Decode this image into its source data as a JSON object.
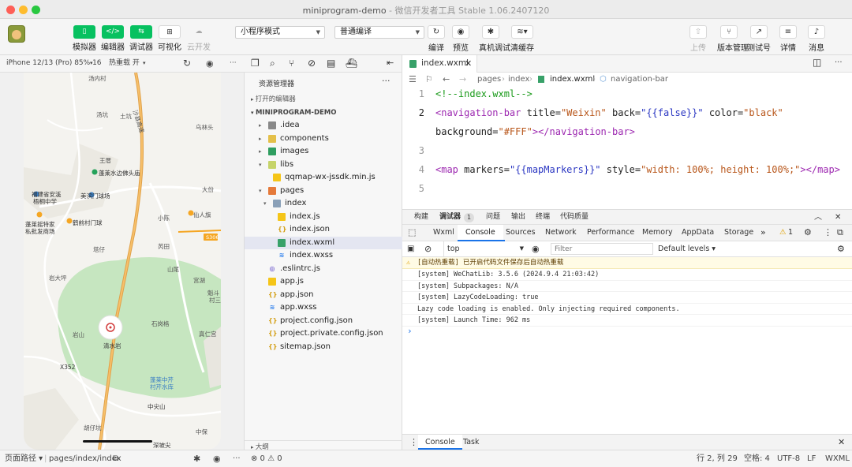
{
  "window": {
    "title": "miniprogram-demo",
    "subtitle": " - 微信开发者工具 Stable 1.06.2407120"
  },
  "toolbar": {
    "simulator": "模拟器",
    "editor": "编辑器",
    "debugger": "调试器",
    "visual": "可视化",
    "cloud": "云开发",
    "mode_select": "小程序模式",
    "compile_select": "普通编译",
    "compile": "编译",
    "preview": "预览",
    "remote_debug": "真机调试",
    "clear_cache": "清缓存",
    "upload": "上传",
    "version": "版本管理",
    "test_account": "测试号",
    "details": "详情",
    "messages": "消息"
  },
  "simulator": {
    "device": "iPhone 12/13 (Pro) 85% 16",
    "hot_reload": "热重载 开"
  },
  "map_labels": {
    "l1": "汤内村",
    "l2": "沙县高速",
    "l3": "汤坑",
    "l4": "土坑",
    "l5": "乌林头",
    "l6": "王厝",
    "l7": "蓬莱水边佛头庙",
    "l8": "福建省安溪",
    "l9": "梧桐中学",
    "l10": "美滨门球场",
    "l11": "大份",
    "l12": "蓬莱摇特家",
    "l13": "私批发商场",
    "l14": "鹤前村门球",
    "l15": "小陈",
    "l16": "仙人旗",
    "l17": "塔仔",
    "l18": "芮田",
    "l19": "S306",
    "l20": "岩大坪",
    "l21": "山尾",
    "l22": "宫湖",
    "l23": "魁斗",
    "l24": "村三",
    "l25": "石岗格",
    "l26": "岩山",
    "l27": "清水岩",
    "l28": "真仁宫",
    "l29": "X352",
    "l30": "蓬莱中芹",
    "l31": "村芹水库",
    "l32": "中尖山",
    "l33": "胡仔坑",
    "l34": "中保",
    "l35": "深坡尖"
  },
  "explorer": {
    "title": "资源管理器",
    "more": "···",
    "open_editors": "打开的编辑器",
    "project": "MINIPROGRAM-DEMO",
    "items": [
      {
        "name": ".idea"
      },
      {
        "name": "components"
      },
      {
        "name": "images"
      },
      {
        "name": "libs"
      },
      {
        "name": "qqmap-wx-jssdk.min.js"
      },
      {
        "name": "pages"
      },
      {
        "name": "index"
      },
      {
        "name": "index.js"
      },
      {
        "name": "index.json"
      },
      {
        "name": "index.wxml"
      },
      {
        "name": "index.wxss"
      },
      {
        "name": ".eslintrc.js"
      },
      {
        "name": "app.js"
      },
      {
        "name": "app.json"
      },
      {
        "name": "app.wxss"
      },
      {
        "name": "project.config.json"
      },
      {
        "name": "project.private.config.json"
      },
      {
        "name": "sitemap.json"
      }
    ],
    "outline": "大纲",
    "status": "⊗ 0 ⚠ 0"
  },
  "editor": {
    "tab": "index.wxml",
    "breadcrumb": {
      "b1": "pages",
      "b2": "index",
      "b3": "index.wxml",
      "b4": "navigation-bar"
    },
    "lines": {
      "n1": "1",
      "n2": "2",
      "n3": "3",
      "n4": "4",
      "n5": "5"
    },
    "code": {
      "c1": "<!--index.wxml-->",
      "c2a": "<navigation-bar",
      "c2b": " title=",
      "c2c": "\"Weixin\"",
      "c2d": " back=",
      "c2e": "\"{{false}}\"",
      "c2f": " color=",
      "c2g": "\"black\"",
      "c2h": "background=",
      "c2i": "\"#FFF\"",
      "c2j": "></navigation-bar>",
      "c4a": "<map",
      "c4b": " markers=",
      "c4c": "\"{{mapMarkers}}\"",
      "c4d": " style=",
      "c4e": "\"width: 100%; height: 100%;\"",
      "c4f": "></map>"
    }
  },
  "devtools": {
    "tabs": {
      "build": "构建",
      "debugger": "调试器",
      "badge": "1",
      "issues": "问题",
      "output": "输出",
      "terminal": "终端",
      "code_quality": "代码质量"
    },
    "panels": {
      "wxml": "Wxml",
      "console": "Console",
      "sources": "Sources",
      "network": "Network",
      "performance": "Performance",
      "memory": "Memory",
      "appdata": "AppData",
      "storage": "Storage",
      "warn_count": "1"
    },
    "context": "top",
    "filter_placeholder": "Filter",
    "levels": "Default levels ▾",
    "console_lines": {
      "w1": "[自动热重载] 已开启代码文件保存后自动热重载",
      "s1": "[system] WeChatLib: 3.5.6 (2024.9.4 21:03:42)",
      "s2": "[system] Subpackages: N/A",
      "s3": "[system] LazyCodeLoading: true",
      "s4": "Lazy code loading is enabled. Only injecting required components.",
      "s5": "[system] Launch Time: 962 ms"
    },
    "prompt": "›",
    "drawer": {
      "console": "Console",
      "task": "Task"
    }
  },
  "statusbar": {
    "page_path_label": "页面路径 ▾",
    "page_path": "pages/index/index",
    "position": "行 2, 列 29",
    "spaces": "空格: 4",
    "encoding": "UTF-8",
    "eol": "LF",
    "language": "WXML"
  },
  "colors": {
    "accent": "#07c160",
    "map_green": "#c6e6c0",
    "road": "#f5a623"
  }
}
